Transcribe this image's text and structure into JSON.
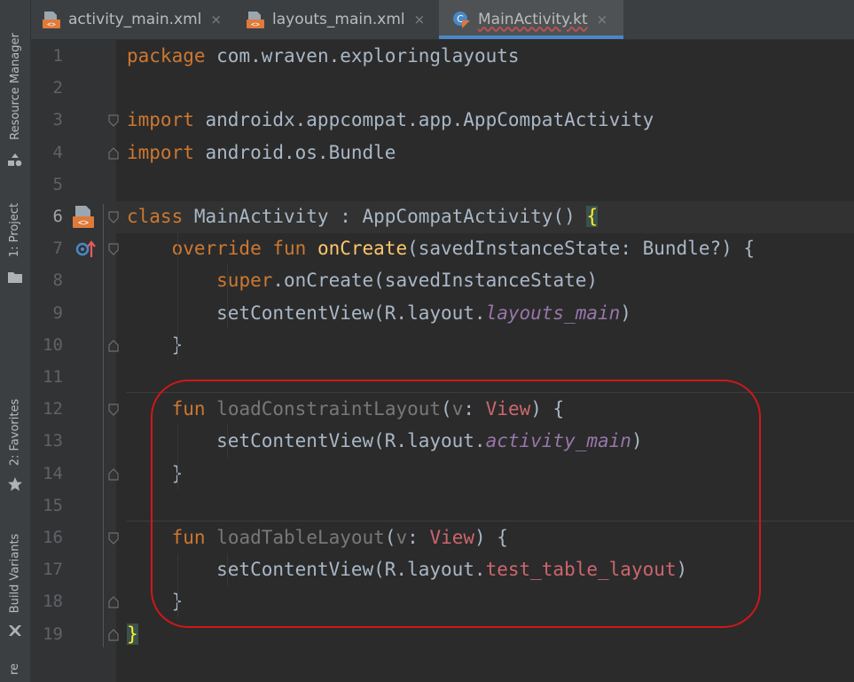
{
  "sidebar": {
    "tools": [
      {
        "label": "Resource Manager",
        "icon": "resource-manager-icon"
      },
      {
        "label": "1: Project",
        "icon": "folder-icon"
      },
      {
        "label": "2: Favorites",
        "icon": "star-icon"
      },
      {
        "label": "Build Variants",
        "icon": "build-variants-icon"
      },
      {
        "label": "re",
        "icon": ""
      }
    ]
  },
  "tabs": [
    {
      "label": "activity_main.xml",
      "icon": "xml-file-icon",
      "active": false
    },
    {
      "label": "layouts_main.xml",
      "icon": "xml-file-icon",
      "active": false
    },
    {
      "label": "MainActivity.kt",
      "icon": "kotlin-file-icon",
      "active": true
    }
  ],
  "tab_close_glyph": "×",
  "editor": {
    "current_line": 6,
    "lines": [
      {
        "n": "1",
        "tokens": [
          {
            "t": "package",
            "c": "kw"
          },
          {
            "t": " com.wraven.exploringlayouts",
            "c": ""
          }
        ]
      },
      {
        "n": "2",
        "tokens": []
      },
      {
        "n": "3",
        "tokens": [
          {
            "t": "import",
            "c": "kw"
          },
          {
            "t": " androidx.appcompat.app.AppCompatActivity",
            "c": ""
          }
        ]
      },
      {
        "n": "4",
        "tokens": [
          {
            "t": "import",
            "c": "kw"
          },
          {
            "t": " android.os.Bundle",
            "c": ""
          }
        ]
      },
      {
        "n": "5",
        "tokens": []
      },
      {
        "n": "6",
        "tokens": [
          {
            "t": "class",
            "c": "kw"
          },
          {
            "t": " MainActivity : AppCompatActivity() ",
            "c": ""
          },
          {
            "t": "{",
            "c": "brace-hl"
          }
        ]
      },
      {
        "n": "7",
        "tokens": [
          {
            "t": "    ",
            "c": ""
          },
          {
            "t": "override fun",
            "c": "kw"
          },
          {
            "t": " ",
            "c": ""
          },
          {
            "t": "onCreate",
            "c": "fn"
          },
          {
            "t": "(savedInstanceState: Bundle?) {",
            "c": ""
          }
        ]
      },
      {
        "n": "8",
        "tokens": [
          {
            "t": "        ",
            "c": ""
          },
          {
            "t": "super",
            "c": "kw"
          },
          {
            "t": ".onCreate(savedInstanceState)",
            "c": ""
          }
        ]
      },
      {
        "n": "9",
        "tokens": [
          {
            "t": "        setContentView(R.layout.",
            "c": ""
          },
          {
            "t": "layouts_main",
            "c": "res"
          },
          {
            "t": ")",
            "c": ""
          }
        ]
      },
      {
        "n": "10",
        "tokens": [
          {
            "t": "    }",
            "c": ""
          }
        ]
      },
      {
        "n": "11",
        "tokens": []
      },
      {
        "n": "12",
        "tokens": [
          {
            "t": "    ",
            "c": ""
          },
          {
            "t": "fun",
            "c": "kw"
          },
          {
            "t": " ",
            "c": ""
          },
          {
            "t": "loadConstraintLayout",
            "c": "unused"
          },
          {
            "t": "(",
            "c": ""
          },
          {
            "t": "v",
            "c": "unused"
          },
          {
            "t": ": ",
            "c": ""
          },
          {
            "t": "View",
            "c": "ty"
          },
          {
            "t": ") {",
            "c": ""
          }
        ]
      },
      {
        "n": "13",
        "tokens": [
          {
            "t": "        setContentView(R.layout.",
            "c": ""
          },
          {
            "t": "activity_main",
            "c": "res"
          },
          {
            "t": ")",
            "c": ""
          }
        ]
      },
      {
        "n": "14",
        "tokens": [
          {
            "t": "    }",
            "c": ""
          }
        ]
      },
      {
        "n": "15",
        "tokens": []
      },
      {
        "n": "16",
        "tokens": [
          {
            "t": "    ",
            "c": ""
          },
          {
            "t": "fun",
            "c": "kw"
          },
          {
            "t": " ",
            "c": ""
          },
          {
            "t": "loadTableLayout",
            "c": "unused"
          },
          {
            "t": "(",
            "c": ""
          },
          {
            "t": "v",
            "c": "unused"
          },
          {
            "t": ": ",
            "c": ""
          },
          {
            "t": "View",
            "c": "ty"
          },
          {
            "t": ") {",
            "c": ""
          }
        ]
      },
      {
        "n": "17",
        "tokens": [
          {
            "t": "        setContentView(R.layout.",
            "c": ""
          },
          {
            "t": "test_table_layout",
            "c": "bad"
          },
          {
            "t": ")",
            "c": ""
          }
        ]
      },
      {
        "n": "18",
        "tokens": [
          {
            "t": "    }",
            "c": ""
          }
        ]
      },
      {
        "n": "19",
        "tokens": [
          {
            "t": "}",
            "c": "brace-hl"
          }
        ]
      }
    ]
  },
  "colors": {
    "keyword": "#cc7832",
    "function": "#ffc66d",
    "resource": "#9876aa",
    "unresolved": "#cc666e",
    "annotation_box": "#d0171a",
    "active_tab_underline": "#4a88c7"
  }
}
